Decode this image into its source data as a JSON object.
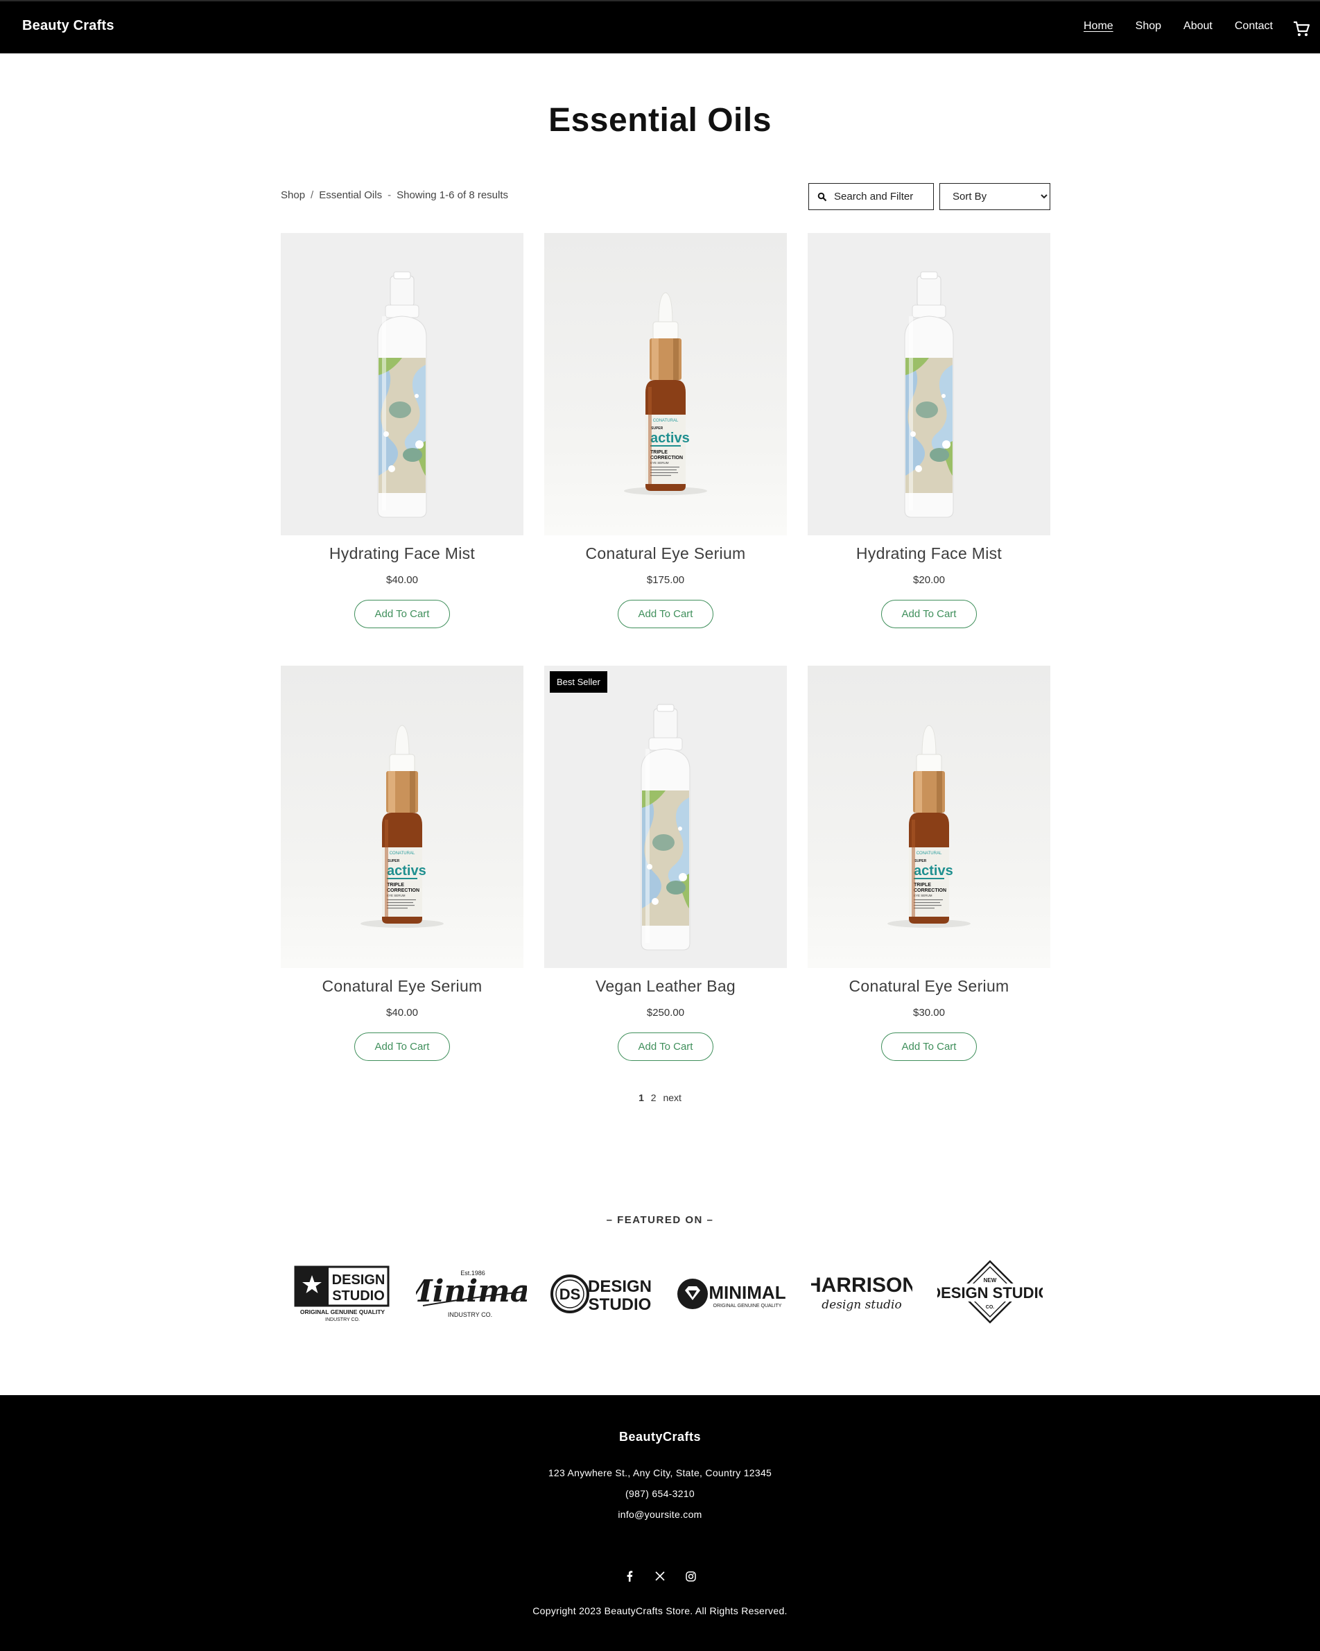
{
  "header": {
    "brand": "Beauty Crafts",
    "nav": [
      "Home",
      "Shop",
      "About",
      "Contact"
    ],
    "active_nav": "Home",
    "cart_icon": "cart-icon"
  },
  "page": {
    "title": "Essential Oils",
    "breadcrumb": [
      "Shop",
      "Essential Oils"
    ],
    "results_text": "Showing 1-6 of 8 results",
    "search_filter_label": "Search and Filter",
    "sort_label": "Sort By"
  },
  "products": [
    {
      "name": "Hydrating Face Mist",
      "price": "$40.00",
      "button": "Add To Cart",
      "image": "spray-bottle",
      "badge": ""
    },
    {
      "name": "Conatural Eye Serium",
      "price": "$175.00",
      "button": "Add To Cart",
      "image": "dropper-bottle",
      "badge": ""
    },
    {
      "name": "Hydrating Face Mist",
      "price": "$20.00",
      "button": "Add To Cart",
      "image": "spray-bottle",
      "badge": ""
    },
    {
      "name": "Conatural Eye Serium",
      "price": "$40.00",
      "button": "Add To Cart",
      "image": "dropper-bottle",
      "badge": ""
    },
    {
      "name": "Vegan Leather Bag",
      "price": "$250.00",
      "button": "Add To Cart",
      "image": "spray-bottle",
      "badge": "Best Seller"
    },
    {
      "name": "Conatural Eye Serium",
      "price": "$30.00",
      "button": "Add To Cart",
      "image": "dropper-bottle",
      "badge": ""
    }
  ],
  "bottle_label": {
    "brand": "CONATURAL",
    "super": "SUPER",
    "product": "activs",
    "line1": "TRIPLE",
    "line2": "CORRECTION",
    "line3": "EYE SERUM"
  },
  "pagination": {
    "pages": [
      "1",
      "2"
    ],
    "next": "next"
  },
  "featured": {
    "title": "–  FEATURED ON  –",
    "logos": [
      {
        "line1": "DESIGN",
        "line2": "STUDIO",
        "sub1": "ORIGINAL GENUINE QUALITY",
        "sub2": "INDUSTRY CO."
      },
      {
        "line1": "Minimal",
        "top": "Est.1986",
        "sub1": "INDUSTRY CO."
      },
      {
        "mono": "DS",
        "line1": "DESIGN",
        "line2": "STUDIO"
      },
      {
        "line1": "MINIMAL",
        "sub1": "ORIGINAL GENUINE QUALITY"
      },
      {
        "line1": "HARRISON",
        "line2": "design studio"
      },
      {
        "line1": "DESIGN STUDIO",
        "top": "NEW",
        "bottom": "CO."
      }
    ]
  },
  "footer": {
    "brand": "BeautyCrafts",
    "address": "123 Anywhere St., Any City, State, Country 12345",
    "phone": "(987) 654-3210",
    "email": "info@yoursite.com",
    "social": [
      "facebook-icon",
      "x-icon",
      "instagram-icon"
    ],
    "copyright": "Copyright 2023 BeautyCrafts Store. All Rights Reserved."
  },
  "colors": {
    "accent": "#3f8f5b",
    "header_bg": "#000000",
    "footer_bg": "#000000",
    "card_bg": "#efefef"
  }
}
